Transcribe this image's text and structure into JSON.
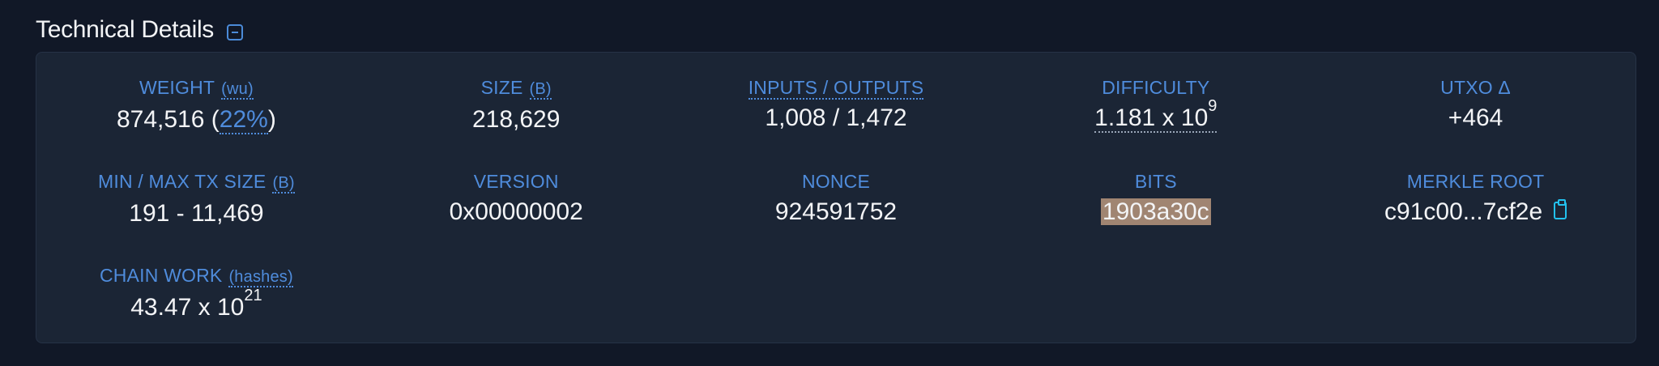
{
  "header": {
    "title": "Technical Details"
  },
  "cells": {
    "weight": {
      "label": "WEIGHT",
      "unit": "(wu)",
      "value": "874,516",
      "open": " (",
      "pct": "22%",
      "close": ")"
    },
    "size": {
      "label": "SIZE",
      "unit": "(B)",
      "value": "218,629"
    },
    "io": {
      "label": "INPUTS / OUTPUTS",
      "value": "1,008 / 1,472"
    },
    "difficulty": {
      "label": "DIFFICULTY",
      "mantissa": "1.181 x 10",
      "exp": "9"
    },
    "utxo": {
      "label": "UTXO Δ",
      "value": "+464"
    },
    "minmax": {
      "label": "MIN / MAX TX SIZE",
      "unit": "(B)",
      "value": "191 - 11,469"
    },
    "version": {
      "label": "VERSION",
      "value": "0x00000002"
    },
    "nonce": {
      "label": "NONCE",
      "value": "924591752"
    },
    "bits": {
      "label": "BITS",
      "value": "1903a30c"
    },
    "merkle": {
      "label": "MERKLE ROOT",
      "value": "c91c00...7cf2e"
    },
    "chainwork": {
      "label": "CHAIN WORK",
      "unit": "(hashes)",
      "mantissa": "43.47 x 10",
      "exp": "21"
    }
  },
  "colors": {
    "accent": "#4f8cdc",
    "highlight": "#a08572",
    "clipboard": "#22c1ee",
    "background": "#111827",
    "card": "#1b2535"
  }
}
